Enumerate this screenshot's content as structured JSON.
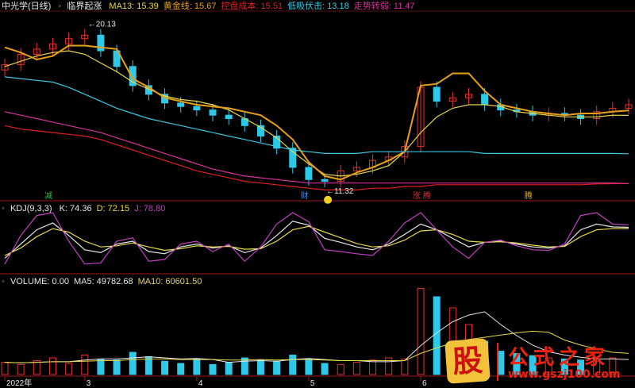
{
  "main_panel": {
    "stock_name": "中光学(日线)",
    "indicator_name": "临界起涨",
    "indicators": [
      {
        "label": "MA13: ",
        "value": "15.39",
        "color": "#e8d84a"
      },
      {
        "label": "黄金线: ",
        "value": "15.67",
        "color": "#e8a01a"
      },
      {
        "label": "控盘成本: ",
        "value": "15.51",
        "color": "#e02020"
      },
      {
        "label": "低吸伏击: ",
        "value": "13.18",
        "color": "#3ac8e0"
      },
      {
        "label": "走势转弱: ",
        "value": "11.47",
        "color": "#d8309a"
      }
    ],
    "high_label": "20.13",
    "low_label": "11.32",
    "signals": [
      {
        "text": "减",
        "color": "#2cc24a"
      },
      {
        "text": "财",
        "color": "#3a8ef0"
      },
      {
        "text": "涨 腾",
        "color": "#e03030"
      },
      {
        "text": "腾",
        "color": "#e8b020"
      }
    ]
  },
  "kdj_panel": {
    "indicator_name": "KDJ(9,3,3)",
    "values": [
      {
        "label": "K: ",
        "value": "74.36",
        "color": "#e8e8e8"
      },
      {
        "label": "D: ",
        "value": "72.15",
        "color": "#e8d84a"
      },
      {
        "label": "J: ",
        "value": "78.80",
        "color": "#c040c0"
      }
    ]
  },
  "volume_panel": {
    "values": [
      {
        "label": "VOLUME: ",
        "value": "0.00",
        "color": "#e8e8e8"
      },
      {
        "label": "MA5: ",
        "value": "49782.68",
        "color": "#e8e8e8"
      },
      {
        "label": "MA10: ",
        "value": "60601.50",
        "color": "#e8d84a"
      }
    ]
  },
  "x_axis": {
    "labels": [
      "2022年",
      "3",
      "4",
      "5",
      "6"
    ]
  },
  "watermark": {
    "logo_char": "股",
    "site_name": "公式之家",
    "url": "www.gszj100.com"
  },
  "chart_data": [
    {
      "type": "line",
      "title": "中光学(日线) 临界起涨",
      "x_label_source": "date",
      "series": [
        {
          "name": "MA13",
          "color": "#e8d84a",
          "values": [
            18.2,
            18.5,
            18.8,
            19.0,
            19.1,
            18.9,
            18.4,
            17.9,
            17.3,
            16.9,
            16.5,
            16.3,
            16.2,
            16.0,
            15.7,
            15.2,
            14.7,
            14.1,
            13.3,
            12.6,
            12.0,
            11.9,
            12.0,
            12.2,
            12.5,
            13.3,
            14.4,
            15.3,
            15.8,
            16.0,
            16.0,
            15.9,
            15.6,
            15.5,
            15.4,
            15.3,
            15.3,
            15.3,
            15.4,
            15.39
          ]
        },
        {
          "name": "黄金线",
          "color": "#e8a01a",
          "values": [
            19.3,
            19.0,
            18.6,
            18.8,
            19.4,
            19.4,
            19.3,
            19.2,
            17.5,
            17.0,
            16.4,
            16.2,
            16.0,
            15.9,
            15.8,
            15.6,
            15.4,
            14.8,
            14.0,
            12.7,
            11.9,
            11.7,
            12.1,
            12.4,
            12.8,
            13.3,
            17.1,
            17.2,
            17.8,
            17.8,
            16.8,
            16.0,
            15.8,
            15.6,
            15.5,
            15.4,
            15.5,
            15.5,
            15.6,
            15.67
          ]
        },
        {
          "name": "控盘成本",
          "color": "#e02020",
          "values": [
            14.8,
            14.6,
            14.5,
            14.4,
            14.3,
            14.2,
            14.0,
            13.7,
            13.4,
            13.1,
            12.8,
            12.5,
            12.2,
            12.0,
            11.8,
            11.6,
            11.5,
            11.4,
            11.3,
            11.2,
            11.1,
            11.1,
            11.1,
            11.2,
            11.2,
            11.3,
            11.3,
            11.4,
            11.4,
            11.4,
            11.4,
            11.4,
            11.4,
            11.4,
            11.4,
            11.4,
            11.4,
            11.45,
            11.46,
            11.47
          ]
        },
        {
          "name": "低吸伏击",
          "color": "#3ac8e0",
          "values": [
            17.6,
            17.5,
            17.4,
            17.3,
            17.0,
            16.6,
            16.2,
            15.8,
            15.5,
            15.2,
            15.0,
            14.8,
            14.6,
            14.4,
            14.2,
            14.0,
            13.8,
            13.6,
            13.4,
            13.3,
            13.2,
            13.2,
            13.2,
            13.3,
            13.3,
            13.3,
            13.3,
            13.3,
            13.3,
            13.3,
            13.2,
            13.2,
            13.2,
            13.2,
            13.2,
            13.2,
            13.2,
            13.2,
            13.2,
            13.18
          ]
        },
        {
          "name": "走势转弱",
          "color": "#d8309a",
          "values": [
            15.6,
            15.4,
            15.2,
            15.0,
            14.8,
            14.6,
            14.4,
            14.1,
            13.8,
            13.5,
            13.2,
            12.9,
            12.6,
            12.3,
            12.1,
            11.9,
            11.8,
            11.7,
            11.6,
            11.5,
            11.5,
            11.5,
            11.5,
            11.5,
            11.5,
            11.5,
            11.5,
            11.5,
            11.5,
            11.5,
            11.5,
            11.5,
            11.5,
            11.5,
            11.5,
            11.5,
            11.5,
            11.5,
            11.5,
            11.47
          ]
        }
      ],
      "candles_close": [
        18.3,
        18.9,
        19.2,
        19.5,
        19.8,
        20.0,
        19.1,
        18.2,
        17.1,
        16.6,
        16.1,
        15.9,
        15.7,
        15.4,
        15.2,
        14.8,
        14.2,
        13.5,
        12.4,
        11.7,
        11.6,
        12.2,
        12.4,
        12.8,
        13.0,
        13.6,
        17.0,
        16.2,
        16.4,
        16.6,
        16.0,
        15.7,
        15.6,
        15.4,
        15.5,
        15.4,
        15.2,
        15.6,
        15.8,
        16.0
      ],
      "ylim": [
        10.8,
        21.2
      ]
    },
    {
      "type": "line",
      "title": "KDJ(9,3,3)",
      "series": [
        {
          "name": "K",
          "color": "#e8e8e8",
          "values": [
            20,
            45,
            70,
            82,
            60,
            35,
            30,
            45,
            50,
            32,
            28,
            40,
            45,
            38,
            42,
            30,
            38,
            60,
            85,
            78,
            55,
            48,
            40,
            35,
            45,
            62,
            80,
            70,
            55,
            40,
            48,
            50,
            45,
            40,
            38,
            42,
            70,
            80,
            75,
            74.36
          ]
        },
        {
          "name": "D",
          "color": "#e8d84a",
          "values": [
            25,
            38,
            58,
            72,
            66,
            50,
            40,
            42,
            47,
            40,
            34,
            37,
            42,
            40,
            41,
            36,
            37,
            50,
            70,
            76,
            66,
            56,
            46,
            40,
            42,
            52,
            68,
            70,
            62,
            50,
            48,
            49,
            47,
            43,
            40,
            41,
            58,
            70,
            72,
            72.15
          ]
        },
        {
          "name": "J",
          "color": "#c040c0",
          "values": [
            10,
            60,
            95,
            100,
            50,
            10,
            12,
            50,
            56,
            15,
            18,
            45,
            50,
            32,
            45,
            15,
            40,
            80,
            100,
            84,
            35,
            32,
            28,
            25,
            50,
            82,
            100,
            70,
            40,
            20,
            48,
            52,
            42,
            35,
            34,
            45,
            95,
            100,
            80,
            78.8
          ]
        }
      ],
      "ylim": [
        0,
        100
      ]
    },
    {
      "type": "bar",
      "title": "VOLUME",
      "series": [
        {
          "name": "VOLUME",
          "values": [
            22,
            18,
            25,
            30,
            20,
            35,
            28,
            26,
            40,
            32,
            24,
            20,
            28,
            18,
            22,
            30,
            26,
            24,
            35,
            28,
            20,
            18,
            22,
            26,
            30,
            28,
            155,
            140,
            120,
            90,
            60,
            42,
            38,
            34,
            30,
            28,
            26,
            24,
            30,
            0
          ]
        },
        {
          "name": "MA5",
          "color": "#e8e8e8",
          "values": [
            22,
            21,
            22,
            23,
            23,
            26,
            28,
            28,
            30,
            32,
            30,
            28,
            29,
            27,
            22,
            24,
            25,
            24,
            27,
            29,
            27,
            25,
            25,
            23,
            23,
            25,
            52,
            75,
            95,
            107,
            113,
            90,
            70,
            53,
            41,
            35,
            31,
            28,
            28,
            27
          ]
        },
        {
          "name": "MA10",
          "color": "#e8d84a",
          "values": [
            22,
            21,
            22,
            23,
            23,
            24,
            25,
            25,
            27,
            28,
            28,
            27,
            27,
            27,
            26,
            26,
            27,
            26,
            27,
            27,
            26,
            25,
            25,
            25,
            25,
            25,
            38,
            48,
            57,
            63,
            67,
            71,
            75,
            78,
            76,
            62,
            53,
            46,
            40,
            38
          ]
        }
      ]
    }
  ]
}
